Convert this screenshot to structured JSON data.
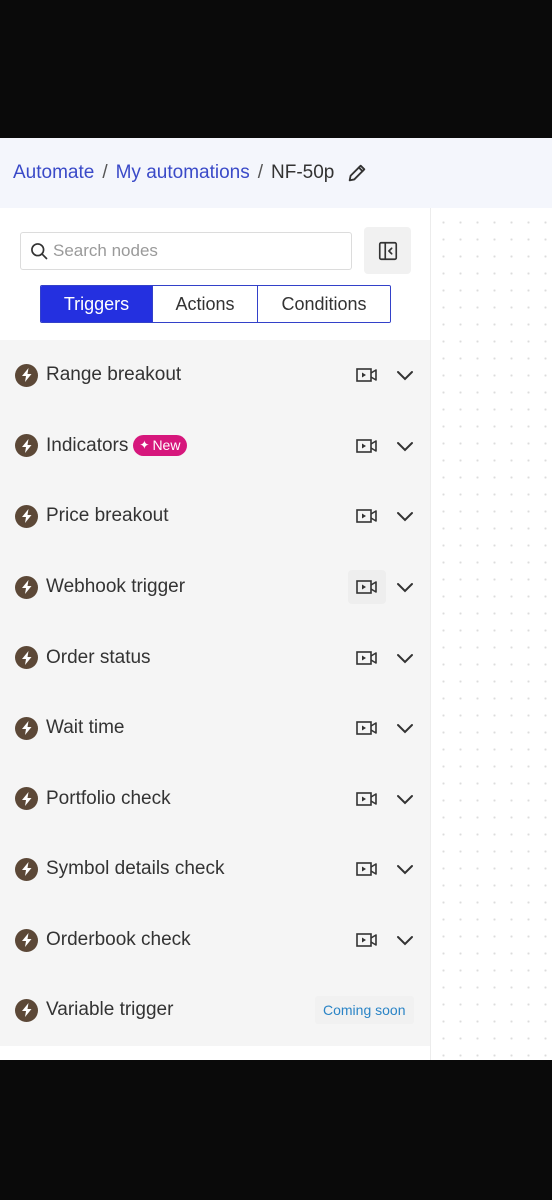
{
  "breadcrumb": {
    "items": [
      "Automate",
      "My automations"
    ],
    "separator": "/",
    "current": "NF-50p"
  },
  "search": {
    "placeholder": "Search nodes",
    "value": ""
  },
  "tabs": [
    {
      "label": "Triggers",
      "active": true
    },
    {
      "label": "Actions",
      "active": false
    },
    {
      "label": "Conditions",
      "active": false
    }
  ],
  "nodes": [
    {
      "label": "Range breakout"
    },
    {
      "label": "Indicators",
      "badge": "New"
    },
    {
      "label": "Price breakout"
    },
    {
      "label": "Webhook trigger"
    },
    {
      "label": "Order status"
    },
    {
      "label": "Wait time"
    },
    {
      "label": "Portfolio check"
    },
    {
      "label": "Symbol details check"
    },
    {
      "label": "Orderbook check"
    },
    {
      "label": "Variable trigger",
      "status": "Coming soon"
    }
  ],
  "colors": {
    "accent": "#2430e0",
    "link": "#3a4ac8",
    "badge": "#d6177c",
    "node_icon": "#5c4837",
    "coming_soon": "#2a84c6"
  },
  "icons": [
    "edit-icon",
    "search-icon",
    "collapse-panel-icon",
    "bolt-icon",
    "video-icon",
    "chevron-down-icon"
  ]
}
